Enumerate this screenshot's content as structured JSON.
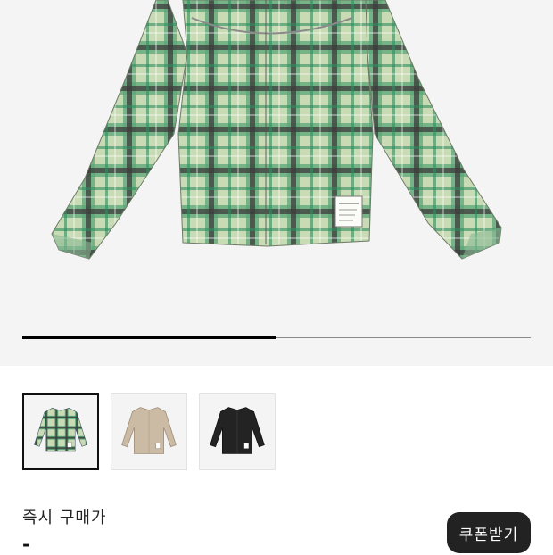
{
  "gallery": {
    "progress": 0.5,
    "total_images": 2
  },
  "thumbnails": [
    {
      "color_name": "green-plaid",
      "selected": true
    },
    {
      "color_name": "beige",
      "selected": false
    },
    {
      "color_name": "black",
      "selected": false
    }
  ],
  "purchase": {
    "label": "즉시 구매가",
    "price": "-"
  },
  "coupon_button": {
    "label": "쿠폰받기"
  },
  "colors": {
    "plaid_dark": "#3c3a3a",
    "plaid_green": "#3f9a6a",
    "plaid_light": "#c9dbb4",
    "beige": "#cbbba5",
    "black_shirt": "#232323",
    "button_bg": "#222222"
  }
}
